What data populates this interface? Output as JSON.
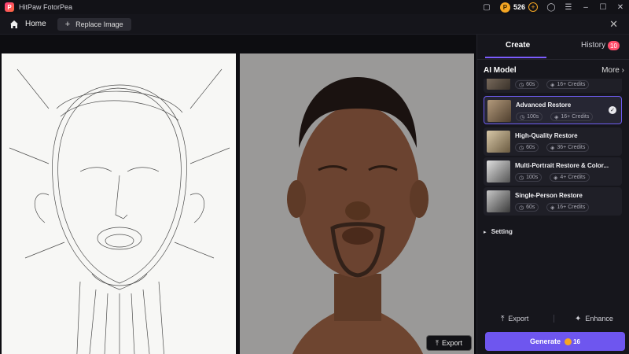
{
  "app": {
    "title": "HitPaw FotorPea",
    "logo_letter": "P"
  },
  "titlebar": {
    "credits": "526"
  },
  "nav": {
    "home_label": "Home",
    "replace_label": "Replace Image"
  },
  "canvas": {
    "export_label": "Export"
  },
  "panel": {
    "tabs": {
      "create": "Create",
      "history": "History",
      "history_badge": "10"
    },
    "section_title": "AI Model",
    "more_label": "More",
    "models": [
      {
        "name": "",
        "time": "60s",
        "credits": "16+ Credits",
        "selected": false
      },
      {
        "name": "Advanced Restore",
        "time": "100s",
        "credits": "16+ Credits",
        "selected": true
      },
      {
        "name": "High-Quality Restore",
        "time": "60s",
        "credits": "36+ Credits",
        "selected": false
      },
      {
        "name": "Multi-Portrait Restore & Color...",
        "time": "100s",
        "credits": "4+ Credits",
        "selected": false
      },
      {
        "name": "Single-Person Restore",
        "time": "60s",
        "credits": "16+ Credits",
        "selected": false
      }
    ],
    "setting_label": "Setting",
    "actions": {
      "export": "Export",
      "enhance": "Enhance"
    },
    "generate": {
      "label": "Generate",
      "cost": "16"
    }
  },
  "colors": {
    "accent": "#6e56ef",
    "badge": "#ff4d6a",
    "coin": "#f5a623"
  },
  "icons": [
    "app-logo-icon",
    "home-icon",
    "plus-icon",
    "close-icon",
    "coin-icon",
    "menu-icon",
    "minimize-icon",
    "maximize-icon",
    "check-icon",
    "clock-icon",
    "credit-icon",
    "export-icon",
    "enhance-icon"
  ]
}
